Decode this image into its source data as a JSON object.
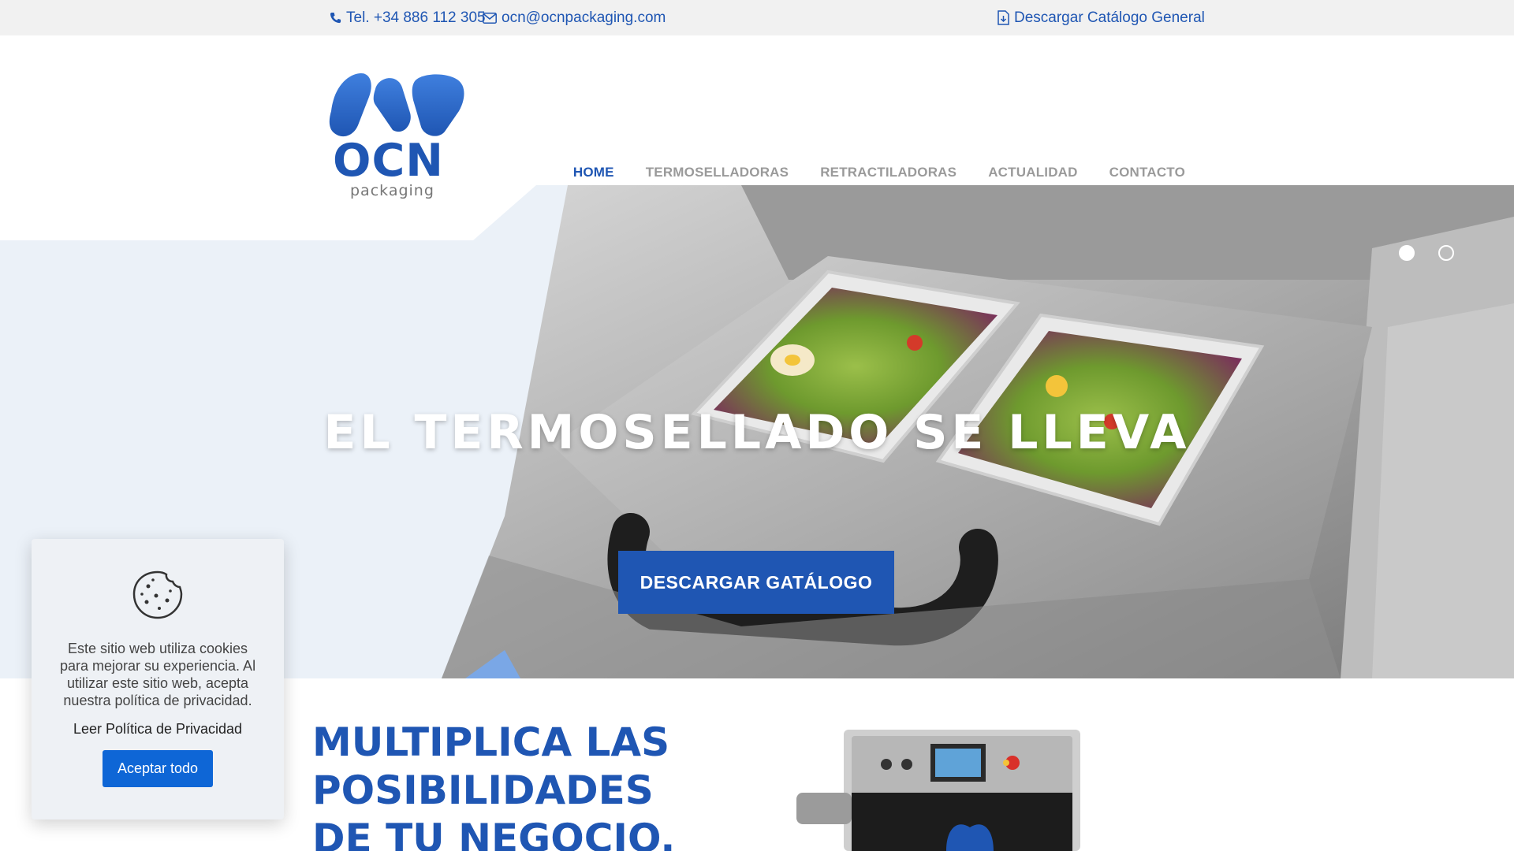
{
  "topbar": {
    "phone": "Tel. +34 886 112 305",
    "email": "ocn@ocnpackaging.com",
    "catalog": "Descargar Catálogo General"
  },
  "logo": {
    "name": "OCN",
    "tagline": "packaging"
  },
  "nav": {
    "items": [
      {
        "label": "HOME",
        "active": true
      },
      {
        "label": "TERMOSELLADORAS",
        "active": false
      },
      {
        "label": "RETRACTILADORAS",
        "active": false
      },
      {
        "label": "ACTUALIDAD",
        "active": false
      },
      {
        "label": "CONTACTO",
        "active": false
      }
    ]
  },
  "hero": {
    "title": "EL TERMOSELLADO SE LLEVA",
    "button": "DESCARGAR GATÁLOGO",
    "slides": 2,
    "active_slide": 1
  },
  "section": {
    "headline": "MULTIPLICA LAS POSIBILIDADES DE TU NEGOCIO."
  },
  "cookie": {
    "text": "Este sitio web utiliza cookies para mejorar su experiencia. Al utilizar este sitio web, acepta nuestra política de privacidad.",
    "link": "Leer Política de Privacidad",
    "accept": "Aceptar todo"
  },
  "colors": {
    "brand": "#1f56b3",
    "nav_inactive": "#9a9a9a",
    "topbar_bg": "#f1f1f1",
    "cookie_button": "#0e66d6",
    "hero_bg": "#ebf1f8"
  }
}
